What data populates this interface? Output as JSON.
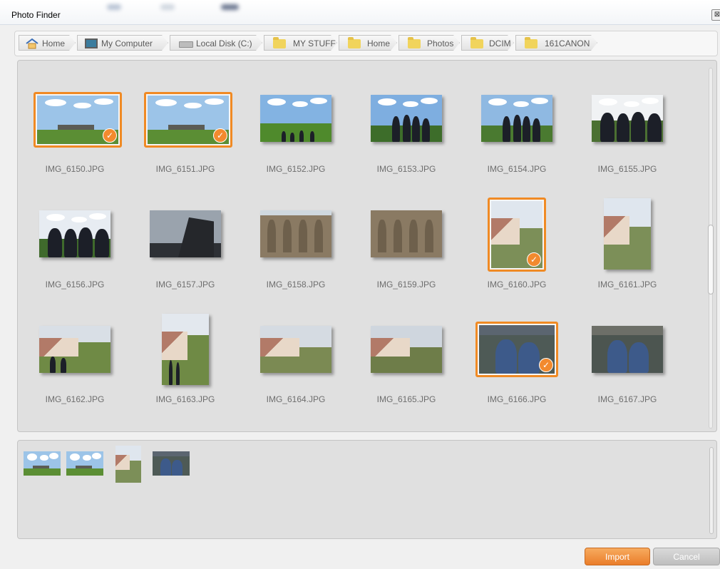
{
  "window": {
    "title": "Photo Finder",
    "close_glyph": "⊠"
  },
  "breadcrumb": [
    {
      "label": "Home",
      "icon": "home-icon"
    },
    {
      "label": "My Computer",
      "icon": "computer-icon"
    },
    {
      "label": "Local Disk (C:)",
      "icon": "disk-icon"
    },
    {
      "label": "MY STUFF",
      "icon": "folder-icon"
    },
    {
      "label": "Home",
      "icon": "folder-icon"
    },
    {
      "label": "Photos",
      "icon": "folder-icon"
    },
    {
      "label": "DCIM",
      "icon": "folder-icon"
    },
    {
      "label": "161CANON",
      "icon": "folder-icon"
    }
  ],
  "photos": [
    {
      "name": "IMG_6150.JPG",
      "selected": true
    },
    {
      "name": "IMG_6151.JPG",
      "selected": true
    },
    {
      "name": "IMG_6152.JPG",
      "selected": false
    },
    {
      "name": "IMG_6153.JPG",
      "selected": false
    },
    {
      "name": "IMG_6154.JPG",
      "selected": false
    },
    {
      "name": "IMG_6155.JPG",
      "selected": false
    },
    {
      "name": "IMG_6156.JPG",
      "selected": false
    },
    {
      "name": "IMG_6157.JPG",
      "selected": false
    },
    {
      "name": "IMG_6158.JPG",
      "selected": false
    },
    {
      "name": "IMG_6159.JPG",
      "selected": false
    },
    {
      "name": "IMG_6160.JPG",
      "selected": true
    },
    {
      "name": "IMG_6161.JPG",
      "selected": false
    },
    {
      "name": "IMG_6162.JPG",
      "selected": false
    },
    {
      "name": "IMG_6163.JPG",
      "selected": false
    },
    {
      "name": "IMG_6164.JPG",
      "selected": false
    },
    {
      "name": "IMG_6165.JPG",
      "selected": false
    },
    {
      "name": "IMG_6166.JPG",
      "selected": true
    },
    {
      "name": "IMG_6167.JPG",
      "selected": false
    }
  ],
  "check_glyph": "✓",
  "buttons": {
    "import_label": "Import",
    "cancel_label": "Cancel"
  },
  "colors": {
    "accent": "#f08a24",
    "panel": "#e0e0e0"
  }
}
